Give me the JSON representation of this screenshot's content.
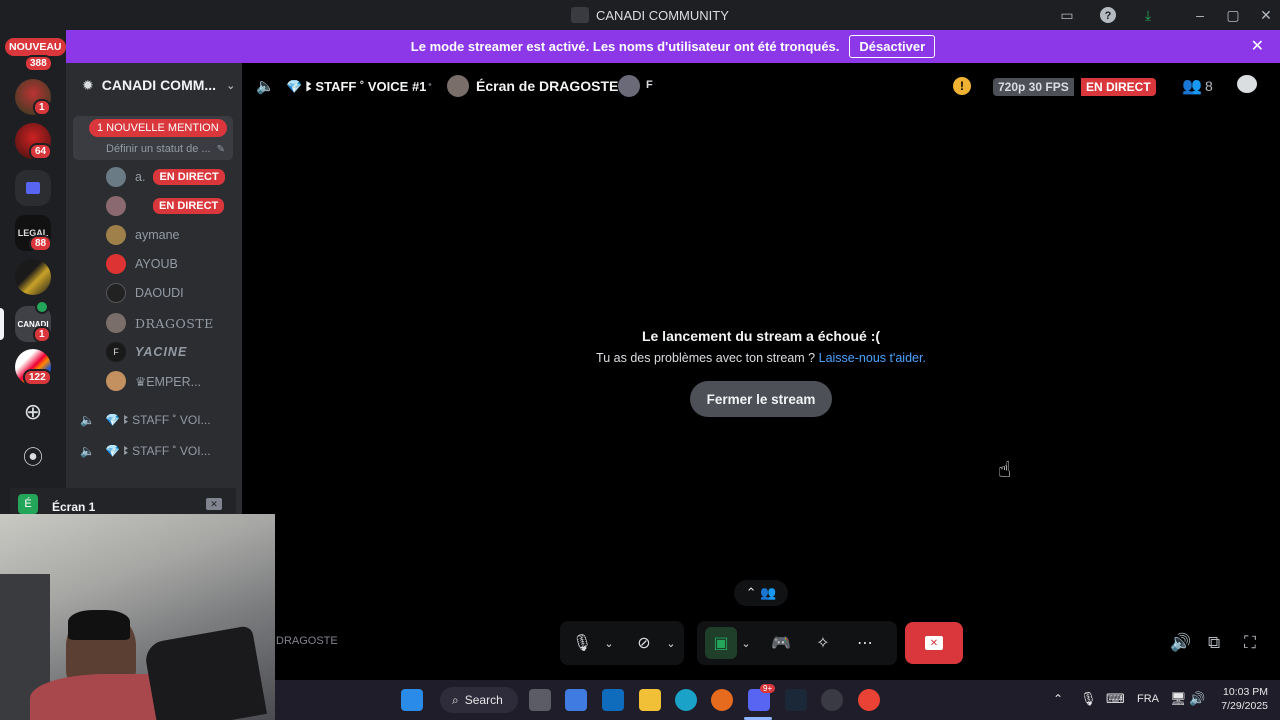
{
  "window": {
    "title": "CANADI COMMUNITY"
  },
  "banner": {
    "message": "Le mode streamer est activé. Les noms d'utilisateur ont été tronqués.",
    "button_label": "Désactiver"
  },
  "rail": {
    "new_label": "NOUVEAU",
    "new_count": "388",
    "badges": [
      "1",
      "64",
      "88",
      "1",
      "122"
    ],
    "canadi_label": "CANADI"
  },
  "sidebar": {
    "server_name": "CANADI COMM...",
    "mention_pill": "1 NOUVELLE MENTION",
    "status_placeholder": "Définir un statut de ...",
    "live_label": "EN DIRECT",
    "members": [
      {
        "name": "a.",
        "live": true
      },
      {
        "name": "",
        "live": true
      },
      {
        "name": "aymane",
        "live": false
      },
      {
        "name": "AYOUB",
        "live": false
      },
      {
        "name": "DAOUDI",
        "live": false
      },
      {
        "name": "DRAGOSTE",
        "live": false
      },
      {
        "name": "YACINE",
        "live": false
      },
      {
        "name": "♛EMPER...",
        "live": false
      }
    ],
    "voice_channels": [
      "💎 ꔪ STAFF ˚ VOI...",
      "💎 ꔪ STAFF ˚ VOI..."
    ]
  },
  "screen_panel": {
    "label": "Écran 1"
  },
  "topbar": {
    "channel": "💎 ꔪ STAFF ˚ VOICE #1",
    "screen_title": "Écran de DRAGOSTE",
    "viewer_initial": "F",
    "quality": "720p 30 FPS",
    "live": "EN DIRECT",
    "viewer_count": "8"
  },
  "stream": {
    "fail_title": "Le lancement du stream a échoué :(",
    "fail_text": "Tu as des problèmes avec ton stream ?",
    "help_link": "Laisse-nous t'aider.",
    "close_button": "Fermer le stream",
    "streamer_tag": "DRAGOSTE"
  },
  "taskbar": {
    "search": "Search",
    "lang": "FRA",
    "time": "10:03 PM",
    "date": "7/29/2025",
    "discord_badge": "9+"
  },
  "colors": {
    "accent_banner": "#8c37e8",
    "live_red": "#da373c",
    "link_blue": "#4aa3ff"
  }
}
